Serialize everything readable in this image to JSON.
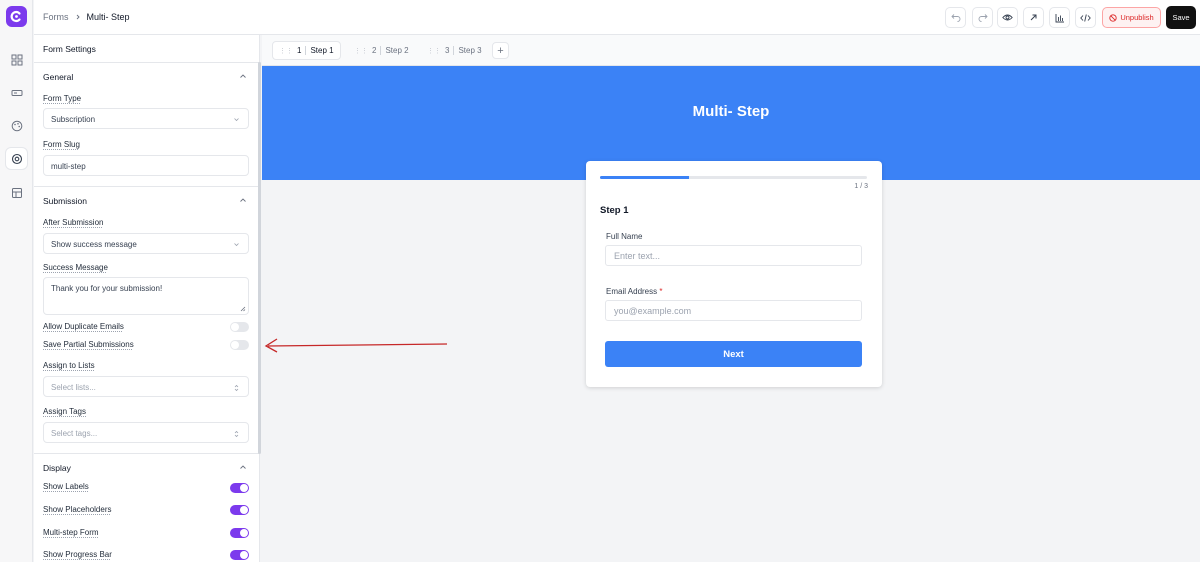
{
  "app": {
    "brand_color": "#7c3aed",
    "accent_color": "#3b82f6"
  },
  "rail": {
    "items": [
      "layout-grid-icon",
      "input-icon",
      "palette-icon",
      "settings-icon",
      "table-icon"
    ],
    "active_index": 3
  },
  "breadcrumb": {
    "root": "Forms",
    "current": "Multi- Step"
  },
  "toolbar": {
    "icons": [
      "undo-icon",
      "redo-icon",
      "eye-icon",
      "external-link-icon",
      "bar-chart-icon",
      "code-icon"
    ],
    "unpublish_label": "Unpublish",
    "save_label": "Save"
  },
  "panel": {
    "title": "Form Settings",
    "general": {
      "heading": "General",
      "form_type_label": "Form Type",
      "form_type_value": "Subscription",
      "form_slug_label": "Form Slug",
      "form_slug_value": "multi-step"
    },
    "submission": {
      "heading": "Submission",
      "after_label": "After Submission",
      "after_value": "Show success message",
      "success_label": "Success Message",
      "success_value": "Thank you for your submission!",
      "allow_duplicates_label": "Allow Duplicate Emails",
      "allow_duplicates": false,
      "save_partial_label": "Save Partial Submissions",
      "save_partial": false,
      "lists_label": "Assign to Lists",
      "lists_placeholder": "Select lists...",
      "tags_label": "Assign Tags",
      "tags_placeholder": "Select tags..."
    },
    "display": {
      "heading": "Display",
      "show_labels_label": "Show Labels",
      "show_labels": true,
      "show_placeholders_label": "Show Placeholders",
      "show_placeholders": true,
      "multistep_label": "Multi-step Form",
      "multistep": true,
      "progress_label": "Show Progress Bar",
      "progress": true
    }
  },
  "steps": {
    "tabs": [
      {
        "num": "1",
        "label": "Step 1"
      },
      {
        "num": "2",
        "label": "Step 2"
      },
      {
        "num": "3",
        "label": "Step 3"
      }
    ],
    "active_index": 0,
    "add_label": "+"
  },
  "form": {
    "title": "Multi- Step",
    "progress_fraction": 0.333,
    "progress_text": "1 / 3",
    "step_title": "Step 1",
    "full_name_label": "Full Name",
    "full_name_placeholder": "Enter text...",
    "email_label": "Email Address",
    "email_required": "*",
    "email_placeholder": "you@example.com",
    "next_label": "Next"
  },
  "annotation": {
    "arrow_color": "#c62828"
  }
}
